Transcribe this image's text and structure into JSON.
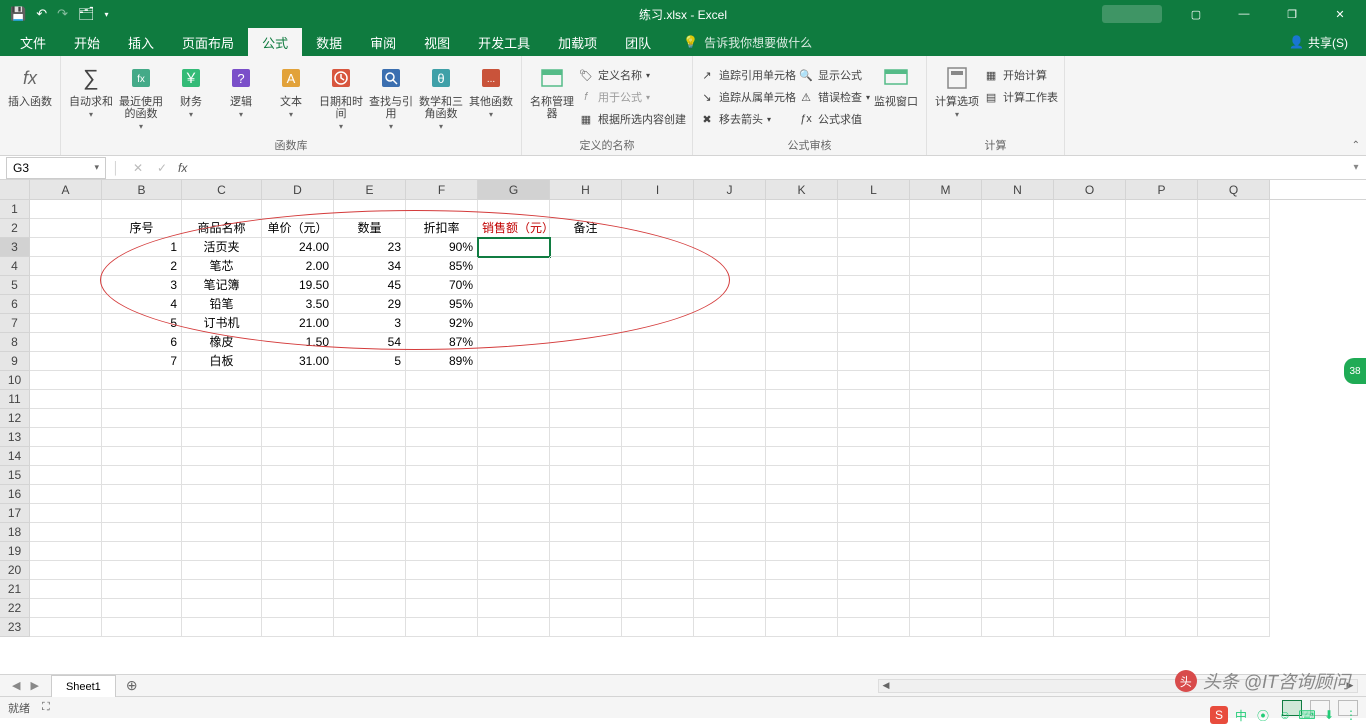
{
  "title": "练习.xlsx - Excel",
  "qat": {
    "save": "💾",
    "undo": "↶",
    "redo": "↷",
    "touch": "🗂"
  },
  "win": {
    "ribbon_opts": "▢",
    "min": "—",
    "max": "❐",
    "close": "✕"
  },
  "tabs": [
    "文件",
    "开始",
    "插入",
    "页面布局",
    "公式",
    "数据",
    "审阅",
    "视图",
    "开发工具",
    "加载项",
    "团队"
  ],
  "active_tab": 4,
  "tell_me": "告诉我你想要做什么",
  "share": "共享(S)",
  "ribbon": {
    "insert_fn": "插入函数",
    "lib": {
      "autosum": "自动求和",
      "recent": "最近使用的函数",
      "financial": "财务",
      "logical": "逻辑",
      "text": "文本",
      "datetime": "日期和时间",
      "lookup": "查找与引用",
      "math": "数学和三角函数",
      "more": "其他函数",
      "label": "函数库"
    },
    "names": {
      "manager": "名称管理器",
      "define": "定义名称",
      "use": "用于公式",
      "create": "根据所选内容创建",
      "label": "定义的名称"
    },
    "audit": {
      "precedents": "追踪引用单元格",
      "dependents": "追踪从属单元格",
      "remove_arrows": "移去箭头",
      "show_formulas": "显示公式",
      "error_check": "错误检查",
      "evaluate": "公式求值",
      "watch": "监视窗口",
      "label": "公式审核"
    },
    "calc": {
      "options": "计算选项",
      "now": "开始计算",
      "sheet": "计算工作表",
      "label": "计算"
    }
  },
  "namebox": "G3",
  "fx_symbol": "fx",
  "columns": [
    "A",
    "B",
    "C",
    "D",
    "E",
    "F",
    "G",
    "H",
    "I",
    "J",
    "K",
    "L",
    "M",
    "N",
    "O",
    "P",
    "Q"
  ],
  "selected_col": "G",
  "selected_row": 3,
  "headers": [
    "序号",
    "商品名称",
    "单价（元）",
    "数量",
    "折扣率",
    "销售额（元）",
    "备注"
  ],
  "data_rows": [
    {
      "no": "1",
      "name": "活页夹",
      "price": "24.00",
      "qty": "23",
      "disc": "90%"
    },
    {
      "no": "2",
      "name": "笔芯",
      "price": "2.00",
      "qty": "34",
      "disc": "85%"
    },
    {
      "no": "3",
      "name": "笔记簿",
      "price": "19.50",
      "qty": "45",
      "disc": "70%"
    },
    {
      "no": "4",
      "name": "铅笔",
      "price": "3.50",
      "qty": "29",
      "disc": "95%"
    },
    {
      "no": "5",
      "name": "订书机",
      "price": "21.00",
      "qty": "3",
      "disc": "92%"
    },
    {
      "no": "6",
      "name": "橡皮",
      "price": "1.50",
      "qty": "54",
      "disc": "87%"
    },
    {
      "no": "7",
      "name": "白板",
      "price": "31.00",
      "qty": "5",
      "disc": "89%"
    }
  ],
  "sheet_tab": "Sheet1",
  "status": {
    "ready": "就绪",
    "scroll_lock": "⛶"
  },
  "watermark": "头条 @IT咨询顾问",
  "float_badge": "38",
  "tray_icons": [
    "S",
    "中",
    "⦿",
    "☺",
    "⌨",
    "⬇",
    "⋮"
  ]
}
